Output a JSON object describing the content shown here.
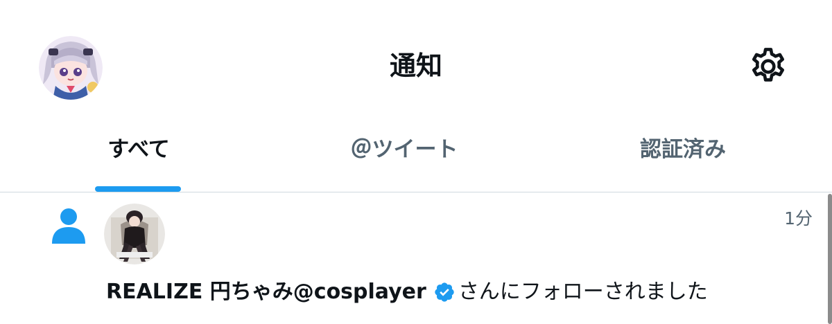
{
  "header": {
    "title": "通知",
    "avatar_icon": "user-avatar-anime-girl",
    "settings_icon": "gear-icon"
  },
  "tabs": [
    {
      "label": "すべて",
      "active": true
    },
    {
      "label": "＠ツイート",
      "active": false
    },
    {
      "label": "認証済み",
      "active": false
    }
  ],
  "notification": {
    "type_icon": "person-follow-icon",
    "timestamp": "1分",
    "user_display": "REALIZE 円ちゃみ@cosplayer",
    "verified": true,
    "action_text": "さんにフォローされました"
  },
  "colors": {
    "accent": "#1d9bf0",
    "text_primary": "#0f1419",
    "text_secondary": "#536471",
    "divider": "#cfd9de"
  }
}
